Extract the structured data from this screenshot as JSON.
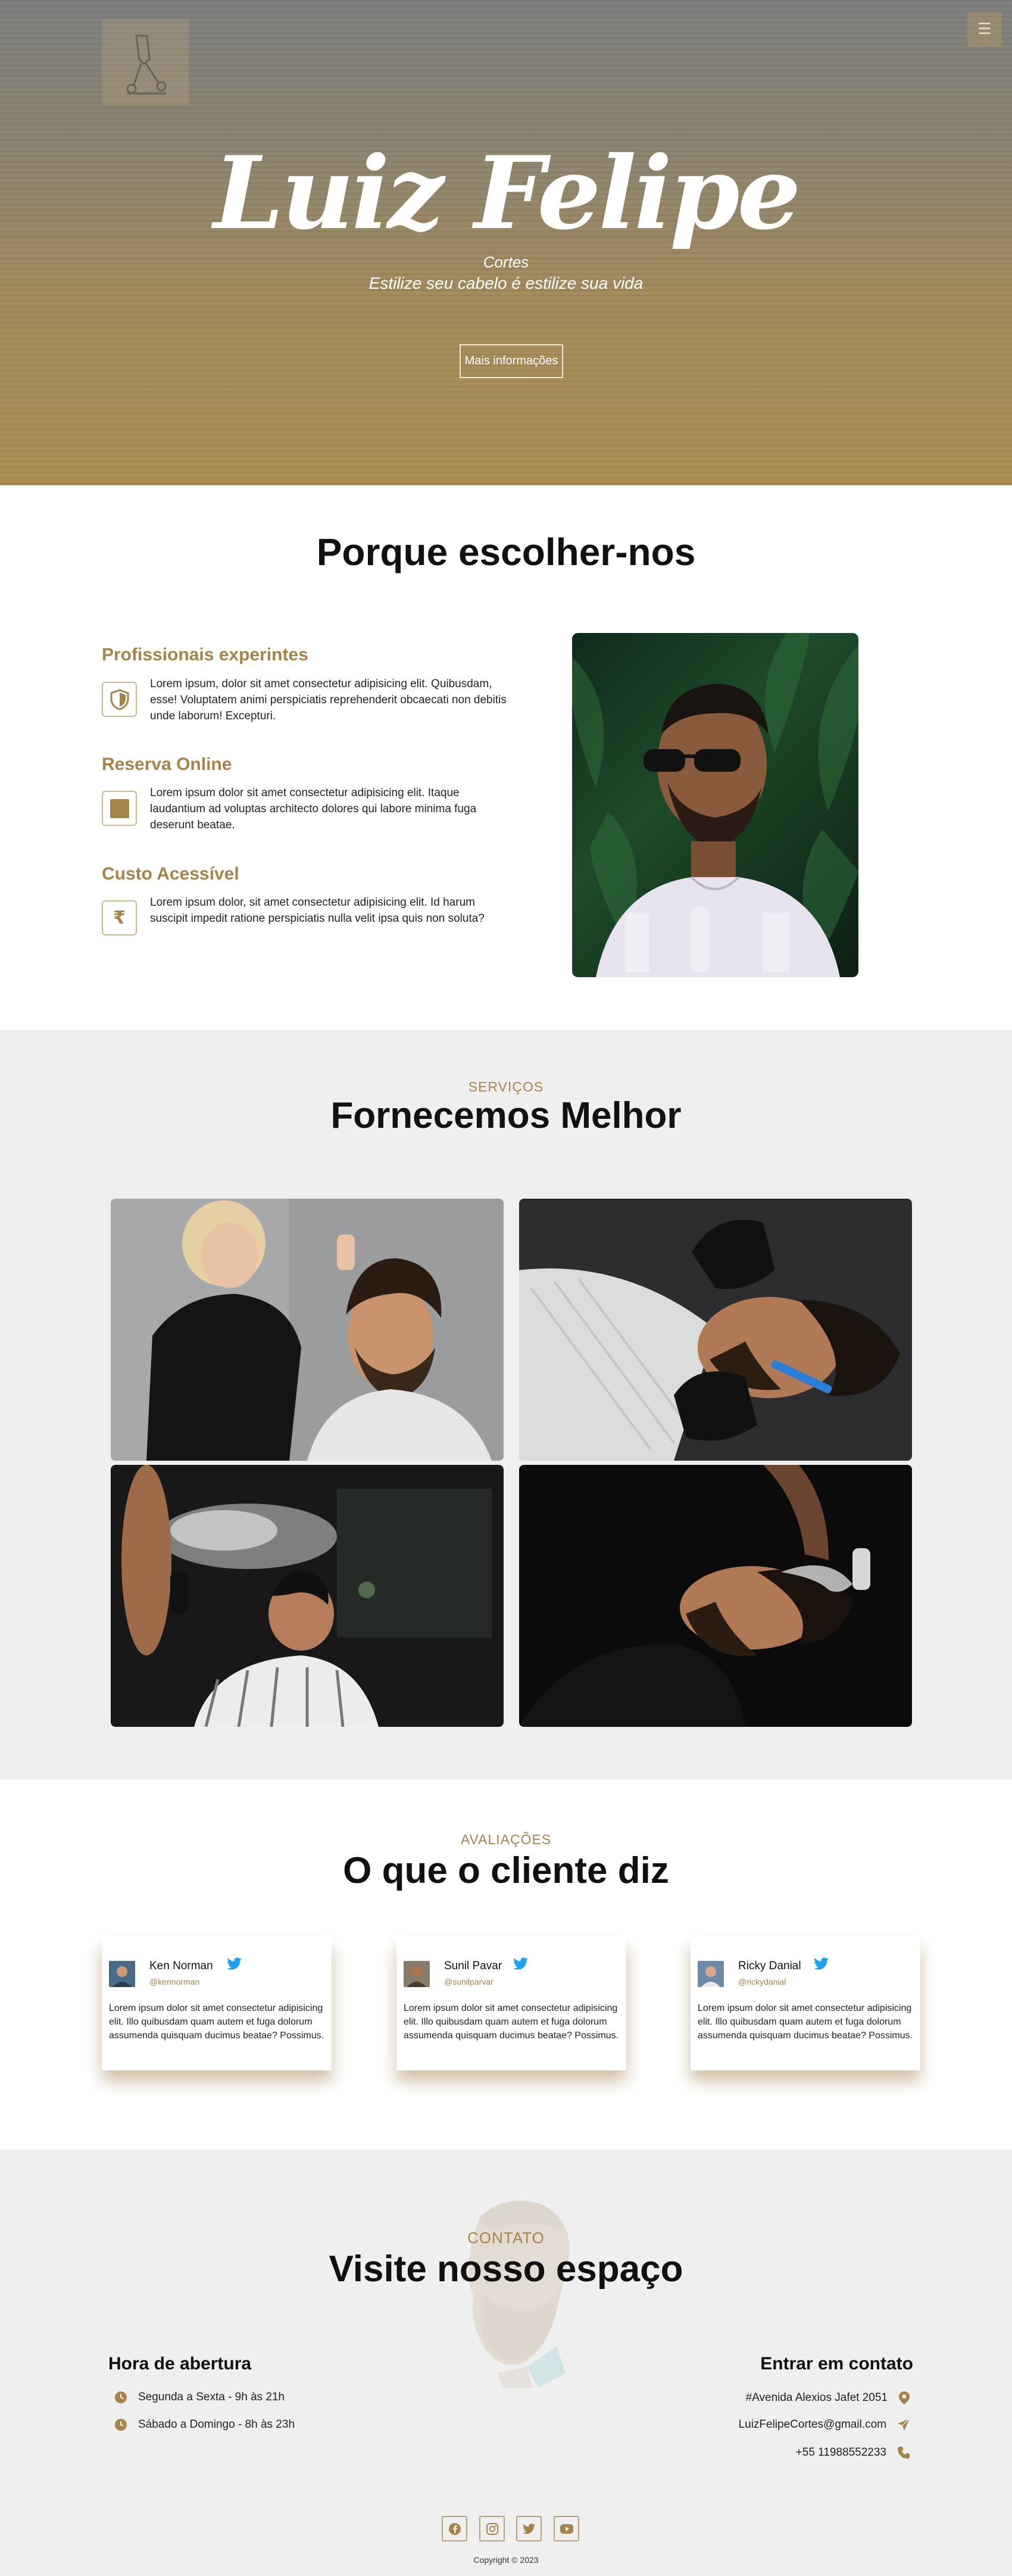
{
  "hero": {
    "title": "Luiz Felipe",
    "subtitle": "Cortes",
    "tagline": "Estilize seu cabelo é estilize sua vida",
    "button_label": "Mais informações",
    "menu_icon": "☰"
  },
  "why": {
    "title": "Porque escolher-nos",
    "features": [
      {
        "icon": "shield-icon",
        "heading": "Profissionais experintes",
        "text": "Lorem ipsum, dolor sit amet consectetur adipisicing elit. Quibusdam, esse! Voluptatem animi perspiciatis reprehenderit obcaecati non debitis unde laborum! Excepturi."
      },
      {
        "icon": "square-icon",
        "heading": "Reserva Online",
        "text": "Lorem ipsum dolor sit amet consectetur adipisicing elit. Itaque laudantium ad voluptas architecto dolores qui labore minima fuga deserunt beatae."
      },
      {
        "icon": "rupee-icon",
        "heading": "Custo Acessível",
        "text": "Lorem ipsum dolor, sit amet consectetur adipisicing elit. Id harum suscipit impedit ratione perspiciatis nulla velit ipsa quis non soluta?"
      }
    ]
  },
  "services": {
    "eyebrow": "SERVIÇOS",
    "title": "Fornecemos Melhor"
  },
  "testimonials": {
    "eyebrow": "AVALIAÇÕES",
    "title": "O que o cliente diz",
    "items": [
      {
        "name": "Ken Norman",
        "handle": "@kennorman",
        "text": "Lorem ipsum dolor sit amet consectetur adipisicing elit. Illo quibusdam quam autem et fuga dolorum assumenda quisquam ducimus beatae? Possimus."
      },
      {
        "name": "Sunil Pavar",
        "handle": "@sunilparvar",
        "text": "Lorem ipsum dolor sit amet consectetur adipisicing elit. Illo quibusdam quam autem et fuga dolorum assumenda quisquam ducimus beatae? Possimus."
      },
      {
        "name": "Ricky Danial",
        "handle": "@rickydanial",
        "text": "Lorem ipsum dolor sit amet consectetur adipisicing elit. Illo quibusdam quam autem et fuga dolorum assumenda quisquam ducimus beatae? Possimus."
      }
    ]
  },
  "contact": {
    "eyebrow": "CONTATO",
    "title": "Visite nosso espaço",
    "hours_heading": "Hora de abertura",
    "hours": [
      "Segunda a Sexta - 9h às 21h",
      "Sábado a Domingo - 8h às 23h"
    ],
    "contact_heading": "Entrar em contato",
    "address": "#Avenida Alexios Jafet 2051",
    "email": "LuizFelipeCortes@gmail.com",
    "phone": "+55 11988552233",
    "social": [
      "facebook-icon",
      "instagram-icon",
      "twitter-icon",
      "youtube-icon"
    ],
    "copyright": "Copyright © 2023"
  },
  "colors": {
    "accent": "#a5834b",
    "hero_top": "#808080",
    "hero_bottom": "#ad8f55",
    "light_bg": "#efefef",
    "twitter": "#1da1f2"
  }
}
